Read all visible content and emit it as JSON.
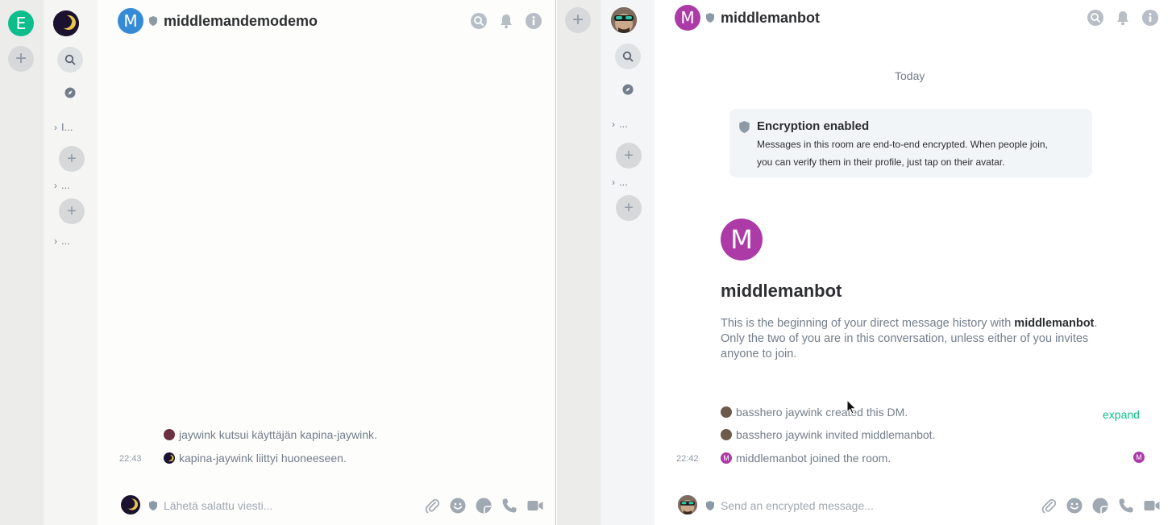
{
  "left_client": {
    "spaces": {
      "home_letter": "E",
      "add_label": "+"
    },
    "room_list": {
      "sections": [
        {
          "label": "I..."
        },
        {
          "label": "..."
        },
        {
          "label": "..."
        }
      ],
      "add_label": "+"
    },
    "room": {
      "name": "middlemandemodemo",
      "avatar_letter": "M",
      "avatar_color": "#368bd6"
    },
    "timeline": [
      {
        "time": "",
        "text": "jaywink kutsui käyttäjän kapina-jaywink."
      },
      {
        "time": "22:43",
        "text": "kapina-jaywink liittyi huoneeseen."
      }
    ],
    "composer": {
      "placeholder": "Lähetä salattu viesti..."
    }
  },
  "right_client": {
    "spaces": {
      "add_label": "+"
    },
    "room_list": {
      "sections": [
        {
          "label": "..."
        },
        {
          "label": "..."
        }
      ],
      "add_label": "+"
    },
    "room": {
      "name": "middlemanbot",
      "avatar_letter": "M",
      "avatar_color": "#ac3ba8"
    },
    "date_divider": "Today",
    "encryption": {
      "title": "Encryption enabled",
      "line1": "Messages in this room are end-to-end encrypted. When people join,",
      "line2": "you can verify them in their profile, just tap on their avatar."
    },
    "intro": {
      "avatar_letter": "M",
      "title": "middlemanbot",
      "text_before": "This is the beginning of your direct message history with ",
      "bold_name": "middlemanbot",
      "text_after": ".",
      "line2": "Only the two of you are in this conversation, unless either of you invites",
      "line3": "anyone to join."
    },
    "timeline": [
      {
        "time": "",
        "text": "basshero jaywink created this DM."
      },
      {
        "time": "",
        "text": "basshero jaywink invited middlemanbot."
      },
      {
        "time": "22:42",
        "text": "middlemanbot joined the room."
      }
    ],
    "expand_label": "expand",
    "composer": {
      "placeholder": "Send an encrypted message..."
    }
  },
  "colors": {
    "accent_green": "#0dbd8b",
    "home_green": "#0dbd8b",
    "secondary_text": "#737d8c",
    "shield": "#8d99a5"
  }
}
